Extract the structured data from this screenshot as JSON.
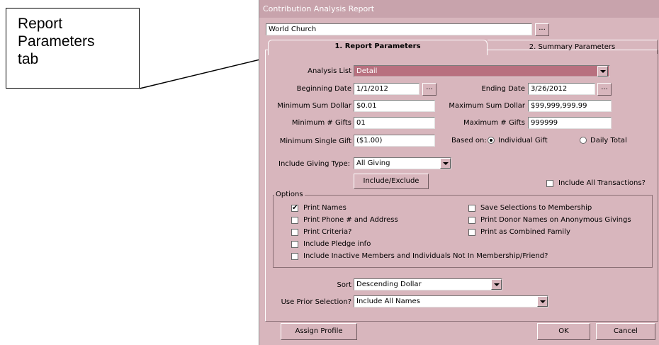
{
  "callout": {
    "text": "Report\nParameters\ntab"
  },
  "window": {
    "title": "Contribution Analysis Report"
  },
  "church": {
    "value": "World Church",
    "browse": "..."
  },
  "tabs": [
    {
      "label": "1. Report Parameters"
    },
    {
      "label": "2. Summary Parameters"
    }
  ],
  "fields": {
    "analysis_list_label": "Analysis List",
    "analysis_list_value": "Detail",
    "beginning_date_label": "Beginning Date",
    "beginning_date_value": "1/1/2012",
    "ending_date_label": "Ending Date",
    "ending_date_value": "3/26/2012",
    "min_sum_label": "Minimum Sum Dollar",
    "min_sum_value": "$0.01",
    "max_sum_label": "Maximum Sum Dollar",
    "max_sum_value": "$99,999,999.99",
    "min_gifts_label": "Minimum # Gifts",
    "min_gifts_value": "01",
    "max_gifts_label": "Maximum # Gifts",
    "max_gifts_value": "999999",
    "min_single_label": "Minimum Single Gift",
    "min_single_value": "($1.00)",
    "based_on_label": "Based on:",
    "individual_gift": "Individual Gift",
    "daily_total": "Daily Total",
    "giving_type_label": "Include Giving Type:",
    "giving_type_value": "All Giving",
    "include_exclude": "Include/Exclude",
    "include_all_transactions": "Include All Transactions?",
    "sort_label": "Sort",
    "sort_value": "Descending Dollar",
    "prior_label": "Use Prior Selection?",
    "prior_value": "Include All Names"
  },
  "options": {
    "legend": "Options",
    "print_names": "Print Names",
    "print_phone": "Print Phone # and Address",
    "print_criteria": "Print Criteria?",
    "include_pledge": "Include Pledge info",
    "include_inactive": "Include Inactive Members and Individuals Not In Membership/Friend?",
    "save_selections": "Save Selections to Membership",
    "print_donor_names": "Print Donor Names on Anonymous Givings",
    "print_combined": "Print as Combined Family"
  },
  "buttons": {
    "assign_profile": "Assign Profile",
    "ok": "OK",
    "cancel": "Cancel"
  },
  "colors": {
    "window_bg": "#d8b6bd",
    "selected_row": "#b8707f",
    "title_bar": "#c8a3ac"
  }
}
